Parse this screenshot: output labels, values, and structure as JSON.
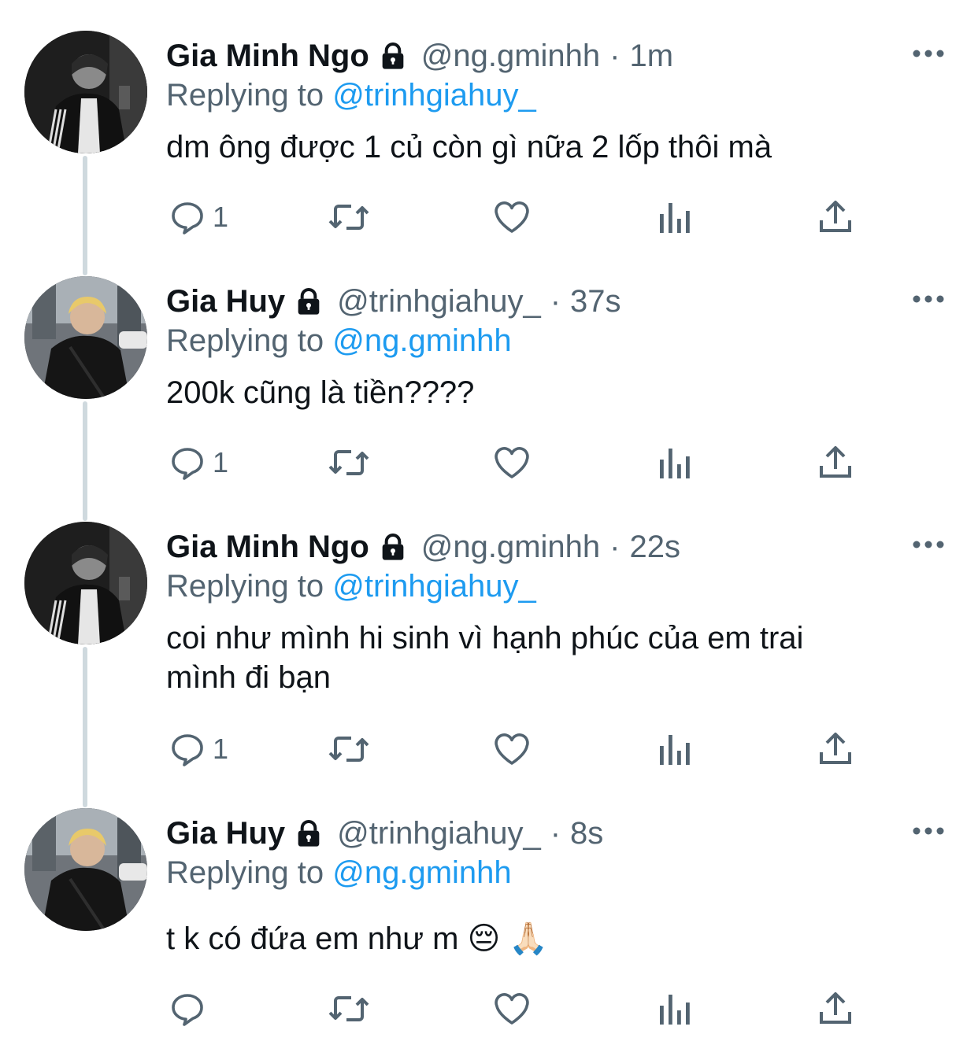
{
  "icons": {
    "lock": "lock-icon",
    "more": "more-icon",
    "reply": "reply-icon",
    "retweet": "retweet-icon",
    "like": "heart-icon",
    "views": "bar-chart-icon",
    "share": "share-icon"
  },
  "colors": {
    "name": "#0f1419",
    "secondary": "#536471",
    "link": "#1d9bf0",
    "thread_line": "#cfd9de"
  },
  "tweets": [
    {
      "name": "Gia Minh Ngo",
      "handle": "@ng.gminhh",
      "separator": "·",
      "time": "1m",
      "replying_prefix": "Replying to",
      "replying_to": "@trinhgiahuy_",
      "text": "dm ông được 1 củ còn gì nữa 2 lốp thôi mà",
      "reply_count": "1"
    },
    {
      "name": "Gia Huy",
      "handle": "@trinhgiahuy_",
      "separator": "·",
      "time": "37s",
      "replying_prefix": "Replying to",
      "replying_to": "@ng.gminhh",
      "text": "200k cũng là tiền????",
      "reply_count": "1"
    },
    {
      "name": "Gia Minh Ngo",
      "handle": "@ng.gminhh",
      "separator": "·",
      "time": "22s",
      "replying_prefix": "Replying to",
      "replying_to": "@trinhgiahuy_",
      "text": "coi như mình hi sinh vì hạnh phúc của em trai mình đi bạn",
      "reply_count": "1"
    },
    {
      "name": "Gia Huy",
      "handle": "@trinhgiahuy_",
      "separator": "·",
      "time": "8s",
      "replying_prefix": "Replying to",
      "replying_to": "@ng.gminhh",
      "text": "t k có đứa em như m 😔 🙏🏻",
      "reply_count": ""
    }
  ]
}
